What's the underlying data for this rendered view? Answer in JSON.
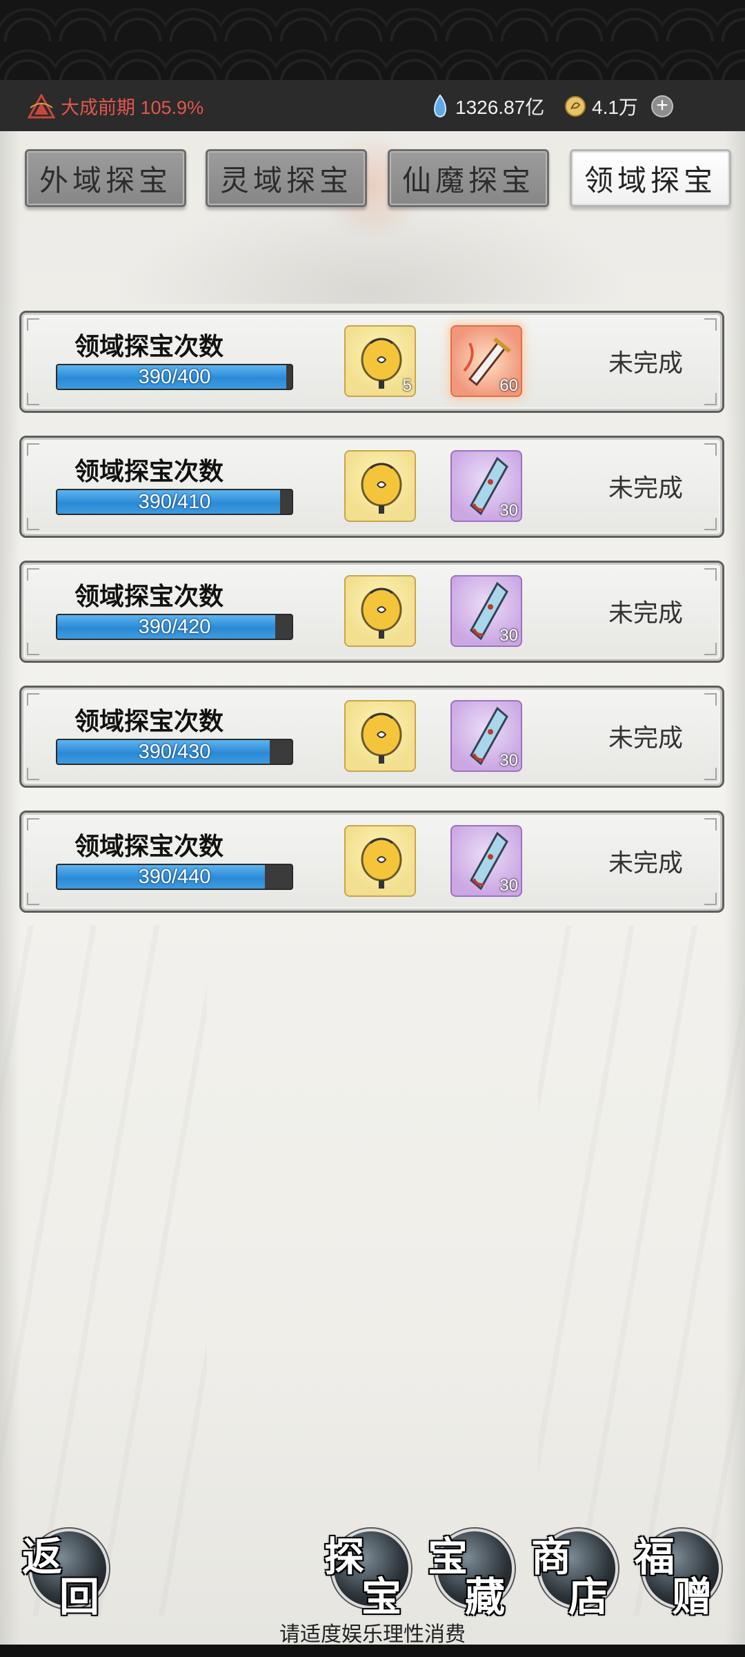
{
  "status_bar": {
    "realm_label": "大成前期 105.9%",
    "currency_spirit_stone": "1326.87亿",
    "currency_gold": "4.1万",
    "add_button": "+"
  },
  "tabs": [
    {
      "label": "外域探宝",
      "active": false
    },
    {
      "label": "灵域探宝",
      "active": false
    },
    {
      "label": "仙魔探宝",
      "active": false
    },
    {
      "label": "领域探宝",
      "active": true
    }
  ],
  "tasks": [
    {
      "title": "领域探宝次数",
      "progress_text": "390/400",
      "progress": 0.975,
      "reward1_qty": "5",
      "reward2_qty": "60",
      "reward2_rarity": "red",
      "status": "未完成"
    },
    {
      "title": "领域探宝次数",
      "progress_text": "390/410",
      "progress": 0.951,
      "reward1_qty": "",
      "reward2_qty": "30",
      "reward2_rarity": "purple",
      "status": "未完成"
    },
    {
      "title": "领域探宝次数",
      "progress_text": "390/420",
      "progress": 0.929,
      "reward1_qty": "",
      "reward2_qty": "30",
      "reward2_rarity": "purple",
      "status": "未完成"
    },
    {
      "title": "领域探宝次数",
      "progress_text": "390/430",
      "progress": 0.907,
      "reward1_qty": "",
      "reward2_qty": "30",
      "reward2_rarity": "purple",
      "status": "未完成"
    },
    {
      "title": "领域探宝次数",
      "progress_text": "390/440",
      "progress": 0.886,
      "reward1_qty": "",
      "reward2_qty": "30",
      "reward2_rarity": "purple",
      "status": "未完成"
    }
  ],
  "nav": {
    "back": [
      "返",
      "回"
    ],
    "treasure_hunt": [
      "探",
      "宝"
    ],
    "treasure": [
      "宝",
      "藏"
    ],
    "shop": [
      "商",
      "店"
    ],
    "gift": [
      "福",
      "赠"
    ]
  },
  "disclaimer": "请适度娱乐理性消费"
}
